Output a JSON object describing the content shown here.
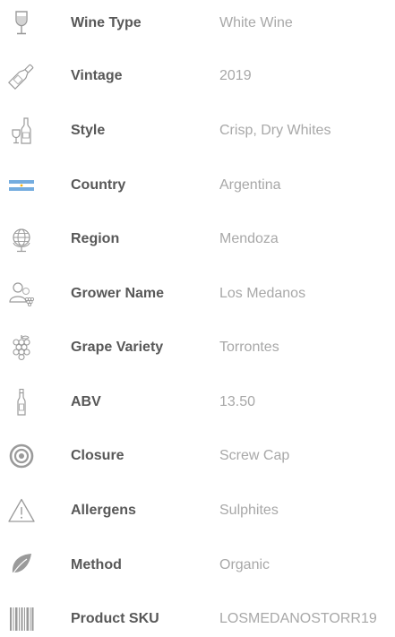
{
  "specs": [
    {
      "icon": "wine-glass-icon",
      "label": "Wine Type",
      "value": "White Wine"
    },
    {
      "icon": "wine-bottle-icon",
      "label": "Vintage",
      "value": "2019"
    },
    {
      "icon": "glass-and-bottle-icon",
      "label": "Style",
      "value": "Crisp, Dry Whites"
    },
    {
      "icon": "argentina-flag-icon",
      "label": "Country",
      "value": "Argentina"
    },
    {
      "icon": "globe-icon",
      "label": "Region",
      "value": "Mendoza"
    },
    {
      "icon": "grower-icon",
      "label": "Grower Name",
      "value": "Los Medanos"
    },
    {
      "icon": "grapes-icon",
      "label": "Grape Variety",
      "value": "Torrontes"
    },
    {
      "icon": "bottle-icon",
      "label": "ABV",
      "value": "13.50"
    },
    {
      "icon": "target-icon",
      "label": "Closure",
      "value": "Screw Cap"
    },
    {
      "icon": "warning-icon",
      "label": "Allergens",
      "value": "Sulphites"
    },
    {
      "icon": "leaf-icon",
      "label": "Method",
      "value": "Organic"
    },
    {
      "icon": "barcode-icon",
      "label": "Product SKU",
      "value": "LOSMEDANOSTORR19"
    }
  ],
  "colors": {
    "label": "#585858",
    "value": "#a8a8a8",
    "icon": "#9a9a9a",
    "flag_blue": "#74acdf",
    "flag_sun": "#f6b40e"
  }
}
